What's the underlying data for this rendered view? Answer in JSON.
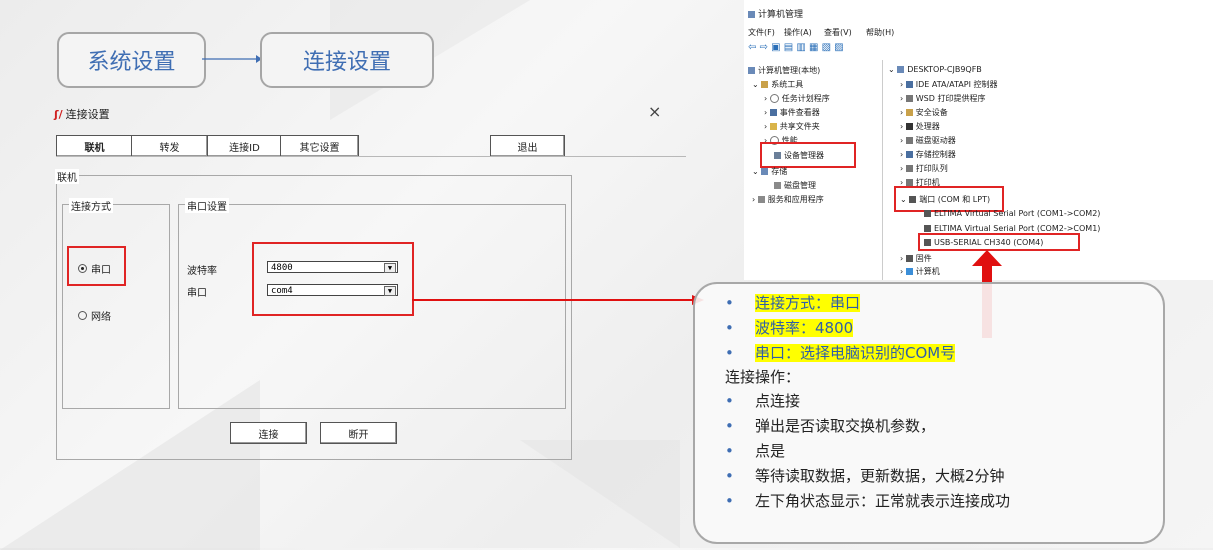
{
  "flow": {
    "step1": "系统设置",
    "step2": "连接设置"
  },
  "dialog": {
    "title": "连接设置",
    "close": "×",
    "tabs": [
      "联机",
      "转发",
      "连接ID",
      "其它设置"
    ],
    "exit": "退出",
    "group_main": "联机",
    "group_conn_method": "连接方式",
    "radio_serial": "串口",
    "radio_network": "网络",
    "group_serial": "串口设置",
    "baud_label": "波特率",
    "baud_value": "4800",
    "port_label": "串口",
    "port_value": "com4",
    "connect": "连接",
    "disconnect": "断开"
  },
  "device_manager": {
    "window_title": "计算机管理",
    "menu": [
      "文件(F)",
      "操作(A)",
      "查看(V)",
      "帮助(H)"
    ],
    "tree_left": [
      "计算机管理(本地)",
      "系统工具",
      "任务计划程序",
      "事件查看器",
      "共享文件夹",
      "性能",
      "设备管理器",
      "存储",
      "磁盘管理",
      "服务和应用程序"
    ],
    "tree_right": [
      "DESKTOP-CJB9QFB",
      "IDE ATA/ATAPI 控制器",
      "WSD 打印提供程序",
      "安全设备",
      "处理器",
      "磁盘驱动器",
      "存储控制器",
      "打印队列",
      "打印机",
      "端口 (COM 和 LPT)",
      "ELTIMA Virtual Serial Port (COM1->COM2)",
      "ELTIMA Virtual Serial Port (COM2->COM1)",
      "USB-SERIAL CH340 (COM4)",
      "固件",
      "计算机"
    ]
  },
  "info": {
    "bullet": "•",
    "lines_hl": [
      "连接方式：串口",
      "波特率：4800",
      "串口：选择电脑识别的COM号"
    ],
    "heading": "连接操作：",
    "steps": [
      "点连接",
      "弹出是否读取交换机参数，",
      "点是",
      "等待读取数据，更新数据，大概2分钟",
      "左下角状态显示：正常就表示连接成功"
    ]
  },
  "colors": {
    "accent": "#3f6eb3",
    "highlight_box": "#e02424",
    "arrow": "#e01010",
    "highlight_text_bg": "#ffff00"
  }
}
